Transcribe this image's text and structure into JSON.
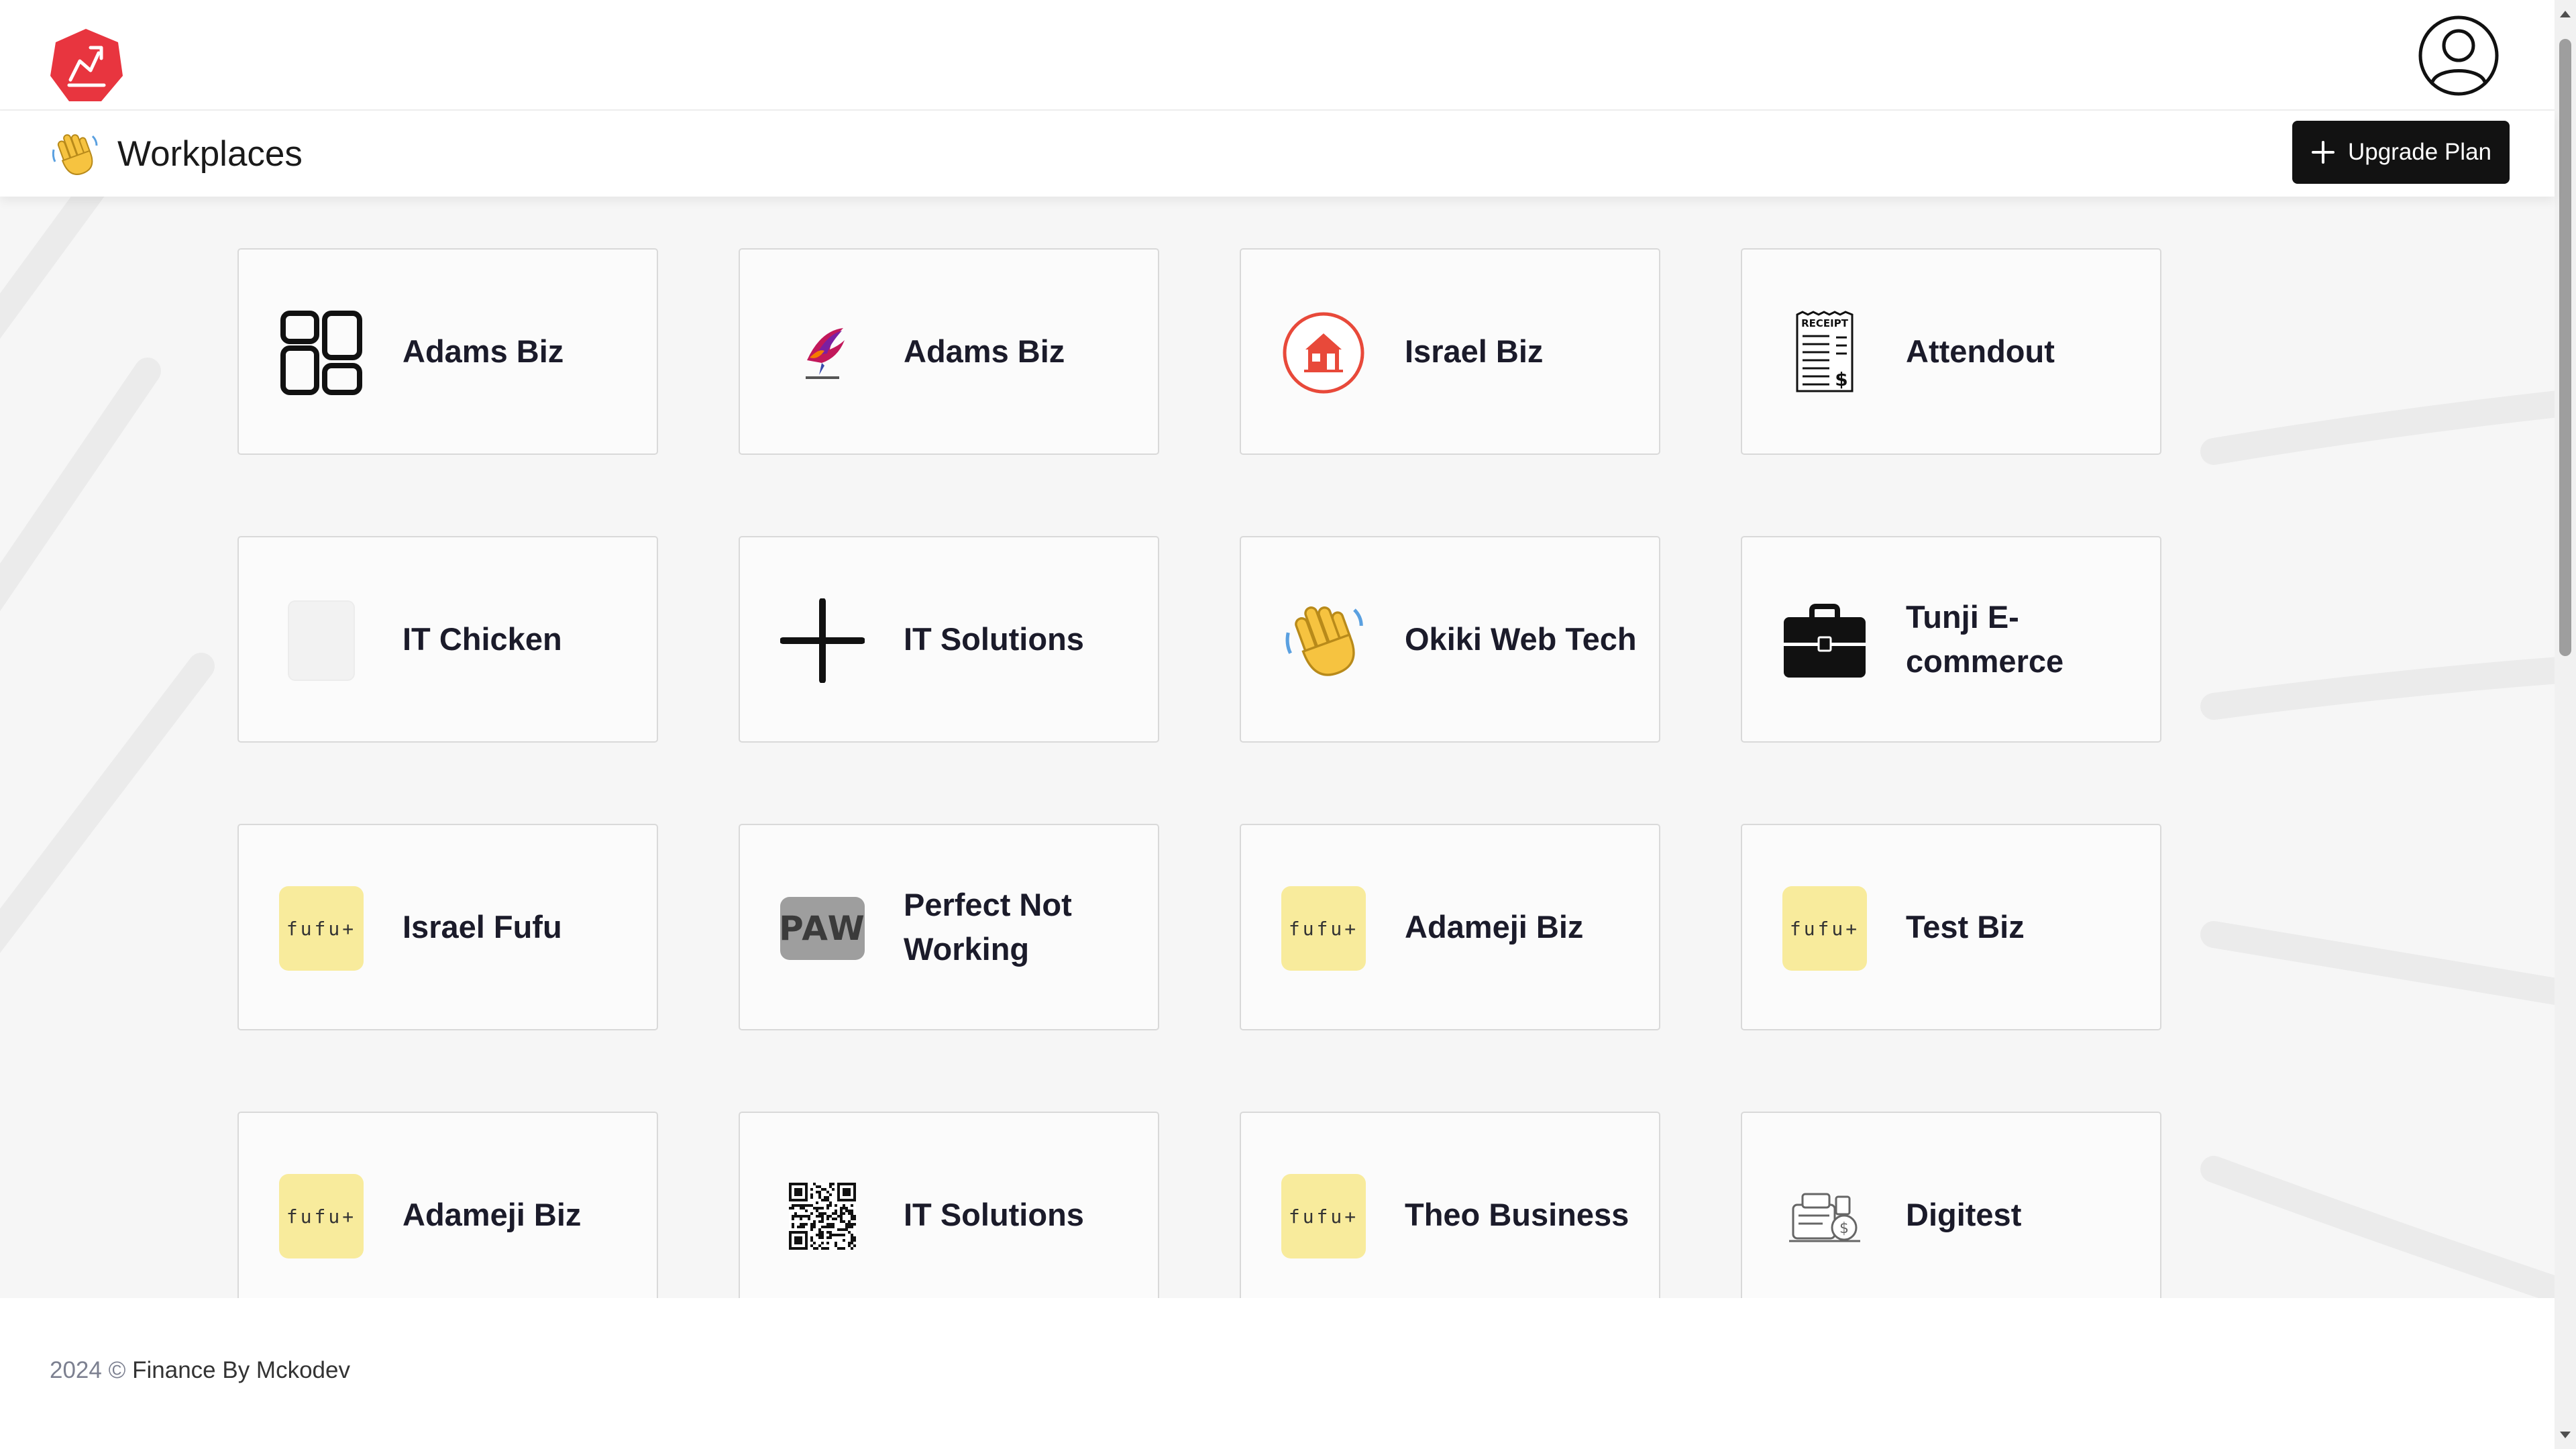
{
  "header": {
    "logo_icon": "app-logo-icon",
    "avatar_icon": "user-avatar-icon",
    "brand_color": "#e8353f"
  },
  "page": {
    "title": "Workplaces",
    "title_icon": "waving-hand-icon",
    "upgrade_label": "Upgrade Plan"
  },
  "workplaces": [
    {
      "name": "Adams Biz",
      "icon": "dashboard-layout-icon"
    },
    {
      "name": "Adams Biz",
      "icon": "bird-logo-icon"
    },
    {
      "name": "Israel Biz",
      "icon": "store-icon"
    },
    {
      "name": "Attendout",
      "icon": "receipt-icon"
    },
    {
      "name": "IT Chicken",
      "icon": "faded-placeholder-icon"
    },
    {
      "name": "IT Solutions",
      "icon": "plus-icon"
    },
    {
      "name": "Okiki Web Tech",
      "icon": "waving-hand-icon"
    },
    {
      "name": "Tunji E-commerce",
      "icon": "briefcase-icon"
    },
    {
      "name": "Israel Fufu",
      "icon": "fufu-logo-icon",
      "logo_text": "fufu+"
    },
    {
      "name": "Perfect Not Working",
      "icon": "paw-logo-icon",
      "logo_text": "PAW"
    },
    {
      "name": "Adameji Biz",
      "icon": "fufu-logo-icon",
      "logo_text": "fufu+"
    },
    {
      "name": "Test Biz",
      "icon": "fufu-logo-icon",
      "logo_text": "fufu+"
    },
    {
      "name": "Adameji Biz",
      "icon": "fufu-logo-icon",
      "logo_text": "fufu+"
    },
    {
      "name": "IT Solutions",
      "icon": "qr-code-icon"
    },
    {
      "name": "Theo Business",
      "icon": "fufu-logo-icon",
      "logo_text": "fufu+"
    },
    {
      "name": "Digitest",
      "icon": "finance-illustration-icon"
    }
  ],
  "footer": {
    "year": "2024 ©",
    "credit": "Finance By Mckodev"
  }
}
